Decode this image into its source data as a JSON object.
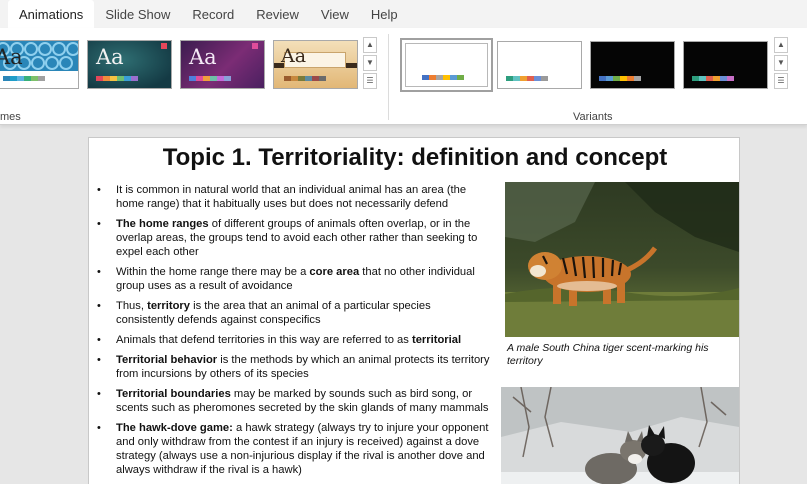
{
  "ribbon": {
    "tabs": [
      {
        "label": "Animations"
      },
      {
        "label": "Slide Show"
      },
      {
        "label": "Record"
      },
      {
        "label": "Review"
      },
      {
        "label": "View"
      },
      {
        "label": "Help"
      }
    ],
    "themes_group_label": "mes",
    "variants_group_label": "Variants",
    "theme_thumb_text": "Aa"
  },
  "colors": {
    "swatch_palette": [
      "#4472c4",
      "#ed7d31",
      "#a5a5a5",
      "#ffc000",
      "#5b9bd5",
      "#70ad47"
    ],
    "variant_palette": [
      "#4472c4",
      "#ed7d31",
      "#a5a5a5",
      "#ffc000",
      "#5b9bd5",
      "#70ad47"
    ]
  },
  "slide": {
    "title": "Topic 1. Territoriality: definition and concept",
    "bullets": [
      {
        "pre": "It is common in natural world that an individual animal has an area (the home range) that it habitually uses but does not necessarily defend",
        "bold": "",
        "post": ""
      },
      {
        "pre": "",
        "bold": "The home ranges",
        "post": " of different groups of animals often overlap, or in the overlap areas, the groups tend to avoid each other rather than seeking to expel each other"
      },
      {
        "pre": "Within the home range there may be a ",
        "bold": "core area",
        "post": " that no other individual group uses as a result of avoidance"
      },
      {
        "pre": "Thus, ",
        "bold": "territory",
        "post": " is the area that an animal of a particular species consistently defends against conspecifics"
      },
      {
        "pre": "Animals that defend territories in this way are referred to as ",
        "bold": "territorial",
        "post": ""
      },
      {
        "pre": "",
        "bold": "Territorial behavior",
        "post": " is the methods by which an animal protects its territory from incursions by others of its species"
      },
      {
        "pre": "",
        "bold": "Territorial boundaries",
        "post": " may be marked by sounds such as bird song, or scents such as pheromones secreted by the skin glands of many mammals"
      },
      {
        "pre": "",
        "bold": "The hawk-dove game:",
        "post": " a hawk strategy (always try to injure your opponent and only withdraw from the contest if an injury is received) against a dove strategy (always use a non-injurious display if the rival is another dove and always withdraw if the rival is a hawk)"
      }
    ],
    "tiger_caption": "A male South China tiger scent-marking his territory"
  }
}
